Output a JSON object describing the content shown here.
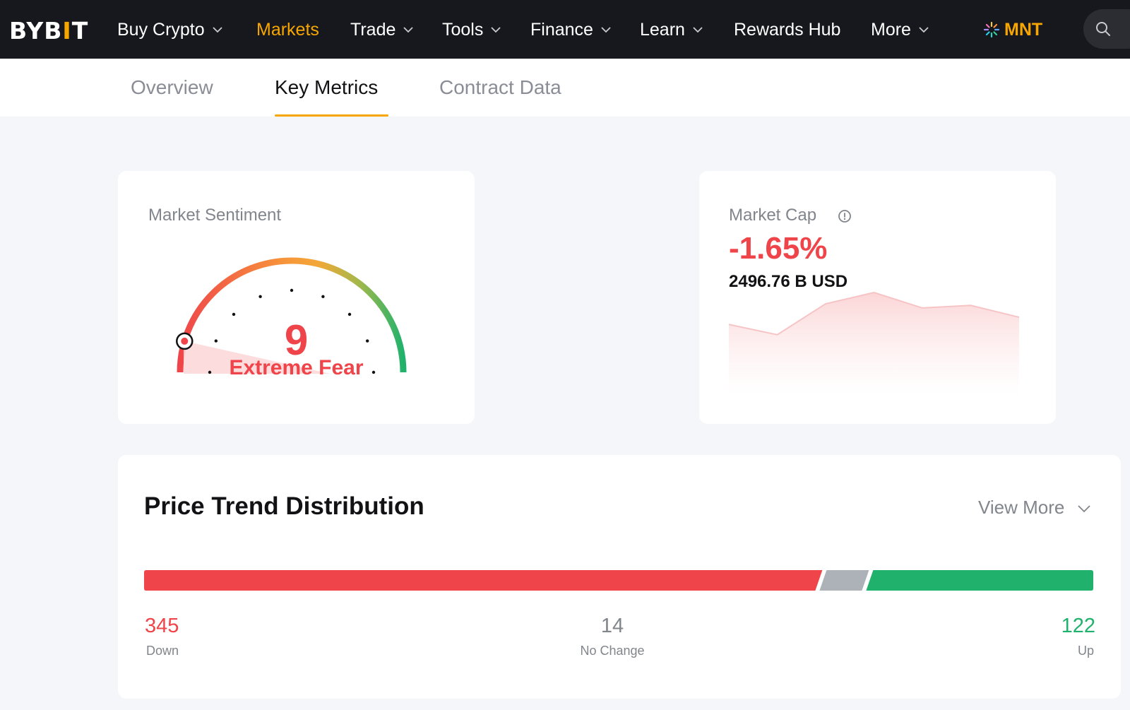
{
  "nav": {
    "logo": "BYBIT",
    "items": [
      {
        "label": "Buy Crypto",
        "has_dropdown": true,
        "active": false
      },
      {
        "label": "Markets",
        "has_dropdown": false,
        "active": true
      },
      {
        "label": "Trade",
        "has_dropdown": true,
        "active": false
      },
      {
        "label": "Tools",
        "has_dropdown": true,
        "active": false
      },
      {
        "label": "Finance",
        "has_dropdown": true,
        "active": false
      },
      {
        "label": "Learn",
        "has_dropdown": true,
        "active": false
      },
      {
        "label": "Rewards Hub",
        "has_dropdown": false,
        "active": false
      },
      {
        "label": "More",
        "has_dropdown": true,
        "active": false
      }
    ],
    "mnt_label": "MNT",
    "search_icon": "search-icon"
  },
  "subtabs": [
    {
      "label": "Overview",
      "active": false
    },
    {
      "label": "Key Metrics",
      "active": true
    },
    {
      "label": "Contract Data",
      "active": false
    }
  ],
  "sentiment": {
    "title": "Market Sentiment",
    "value": "9",
    "level": 9,
    "scale_max": 100,
    "label": "Extreme Fear"
  },
  "market_cap": {
    "title": "Market Cap",
    "change": "-1.65%",
    "amount": "2496.76 B USD",
    "info_icon": "info-icon",
    "sparkline": [
      0.38,
      0.18,
      0.78,
      1.0,
      0.7,
      0.75,
      0.52
    ]
  },
  "trend": {
    "title": "Price Trend Distribution",
    "view_more": "View More",
    "down": {
      "value": "345",
      "label": "Down"
    },
    "no_change": {
      "value": "14",
      "label": "No Change"
    },
    "up": {
      "value": "122",
      "label": "Up"
    }
  },
  "colors": {
    "accent": "#f7a600",
    "down": "#ef454a",
    "up": "#20b26c",
    "neutral": "#adb1b8",
    "nav_bg": "#17181e"
  }
}
